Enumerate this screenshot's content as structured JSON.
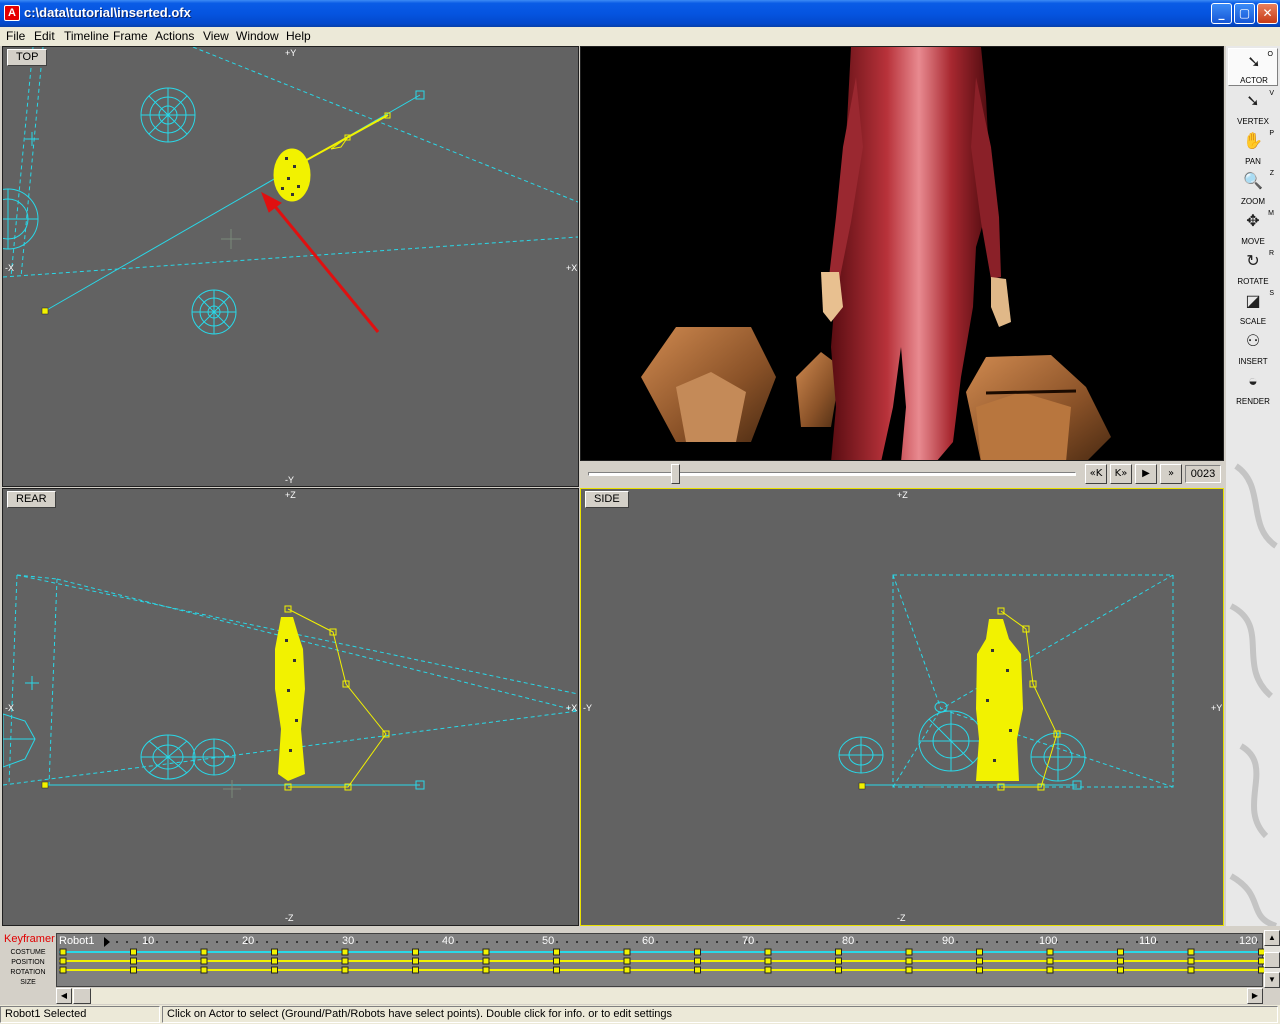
{
  "window": {
    "title": "c:\\data\\tutorial\\inserted.ofx",
    "app_icon": "app-icon",
    "controls": {
      "minimize": "_",
      "maximize": "▢",
      "close": "✕"
    }
  },
  "menu": {
    "items": [
      "File",
      "Edit",
      "Timeline",
      "Frame",
      "Actions",
      "View",
      "Window",
      "Help"
    ]
  },
  "viewports": {
    "top": {
      "label": "TOP",
      "axis_top": "+Y",
      "axis_bottom": "-Y",
      "axis_left": "-X",
      "axis_right": "+X"
    },
    "rear": {
      "label": "REAR",
      "axis_top": "+Z",
      "axis_bottom": "-Z",
      "axis_left": "-X",
      "axis_right": "+X"
    },
    "side": {
      "label": "SIDE",
      "axis_top": "+Z",
      "axis_bottom": "-Z",
      "axis_left": "-Y",
      "axis_right": "+Y"
    },
    "perspective": {
      "description_icon": "render-preview"
    }
  },
  "playback": {
    "slider_fraction": 0.17,
    "buttons": [
      "«K",
      "K»",
      "▶",
      "»"
    ],
    "frame": "0023"
  },
  "tools": [
    {
      "label": "ACTOR",
      "key": "O",
      "icon": "arrow-icon",
      "glyph": "➘",
      "active": true
    },
    {
      "label": "VERTEX",
      "key": "V",
      "icon": "arrow-icon",
      "glyph": "➘",
      "active": false
    },
    {
      "label": "PAN",
      "key": "P",
      "icon": "hand-icon",
      "glyph": "✋",
      "active": false
    },
    {
      "label": "ZOOM",
      "key": "Z",
      "icon": "magnifier-icon",
      "glyph": "🔍",
      "active": false
    },
    {
      "label": "MOVE",
      "key": "M",
      "icon": "move-icon",
      "glyph": "✥",
      "active": false
    },
    {
      "label": "ROTATE",
      "key": "R",
      "icon": "rotate-icon",
      "glyph": "↻",
      "active": false
    },
    {
      "label": "SCALE",
      "key": "S",
      "icon": "scale-icon",
      "glyph": "◪",
      "active": false
    },
    {
      "label": "INSERT",
      "key": "",
      "icon": "insert-icon",
      "glyph": "⚇",
      "active": false
    },
    {
      "label": "RENDER",
      "key": "",
      "icon": "render-icon",
      "glyph": "◒",
      "active": false
    }
  ],
  "keyframer": {
    "title": "Keyframer",
    "rows": [
      "COSTUME",
      "POSITION",
      "ROTATION",
      "SIZE"
    ],
    "actor": "Robot1",
    "frame_numbers": [
      "10",
      "20",
      "30",
      "40",
      "50",
      "60",
      "70",
      "80",
      "90",
      "100",
      "110",
      "120"
    ]
  },
  "status": {
    "selection": "Robot1 Selected",
    "hint": "Click on Actor to select  (Ground/Path/Robots have select points). Double click for info. or to edit settings"
  },
  "colors": {
    "viewport_bg": "#626262",
    "wire_cyan": "#29d8e8",
    "wire_yellow": "#f2f200",
    "arrow_red": "#e01010"
  }
}
